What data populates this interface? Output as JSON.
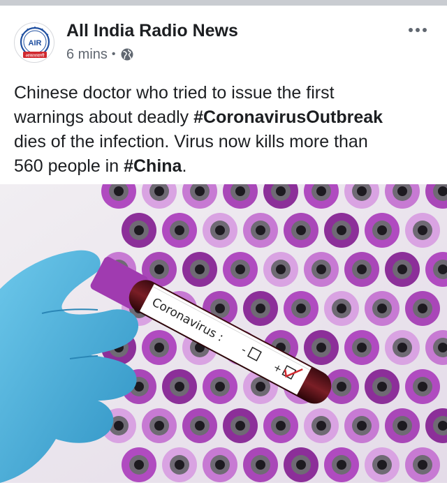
{
  "post": {
    "page_name": "All India Radio News",
    "timestamp": "6 mins",
    "separator": "•",
    "privacy_icon": "globe-icon",
    "more_icon": "more-options-icon",
    "text_line1": "Chinese doctor who tried to issue the first",
    "text_line2_prefix": "warnings about deadly ",
    "hashtag1": "#CoronavirusOutbreak",
    "text_line3": "dies of the infection. Virus now kills more than",
    "text_line4_prefix": "560 people in ",
    "hashtag2": "#China",
    "text_line4_suffix": "."
  },
  "logo": {
    "monogram": "AIR",
    "devanagari": "आकाशवाणी"
  },
  "image": {
    "tube_label": "Coronavirus :",
    "minus_sign": "-",
    "plus_sign": "+"
  },
  "colors": {
    "text_primary": "#1c1e21",
    "text_secondary": "#606770",
    "logo_blue": "#1f4fa0",
    "logo_red": "#d1282e",
    "tube_purple": "#a03bb0",
    "glove_blue": "#4fb4dd"
  }
}
